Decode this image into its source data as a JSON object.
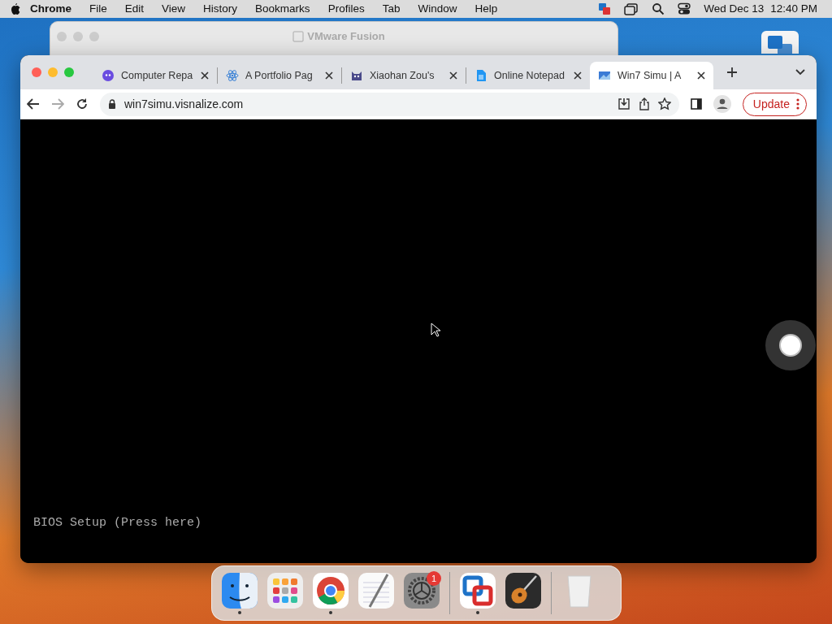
{
  "menu_bar": {
    "app": "Chrome",
    "menus": [
      "File",
      "Edit",
      "View",
      "History",
      "Bookmarks",
      "Profiles",
      "Tab",
      "Window",
      "Help"
    ],
    "date": "Wed Dec 13",
    "time": "12:40 PM"
  },
  "background_window": {
    "title": "VMware Fusion"
  },
  "browser": {
    "tabs": [
      {
        "title": "Computer Repa",
        "kind": "mascot",
        "selected": false
      },
      {
        "title": "A Portfolio Pag",
        "kind": "react",
        "selected": false
      },
      {
        "title": "Xiaohan Zou's",
        "kind": "cat",
        "selected": false
      },
      {
        "title": "Online Notepad",
        "kind": "doc",
        "selected": false
      },
      {
        "title": "Win7 Simu | A",
        "kind": "win",
        "selected": true
      }
    ],
    "address": "win7simu.visnalize.com",
    "update_button": "Update"
  },
  "page": {
    "bios_link": "BIOS Setup (Press here)"
  },
  "dock": {
    "items": [
      {
        "kind": "finder",
        "running": true
      },
      {
        "kind": "launchpad",
        "running": false
      },
      {
        "kind": "chrome",
        "running": true
      },
      {
        "kind": "textedit",
        "running": false
      },
      {
        "kind": "settings",
        "running": false,
        "badge": "1"
      },
      {
        "kind": "separator"
      },
      {
        "kind": "vmware",
        "running": true
      },
      {
        "kind": "guitar",
        "running": false
      },
      {
        "kind": "separator"
      },
      {
        "kind": "trash",
        "running": false
      }
    ]
  }
}
